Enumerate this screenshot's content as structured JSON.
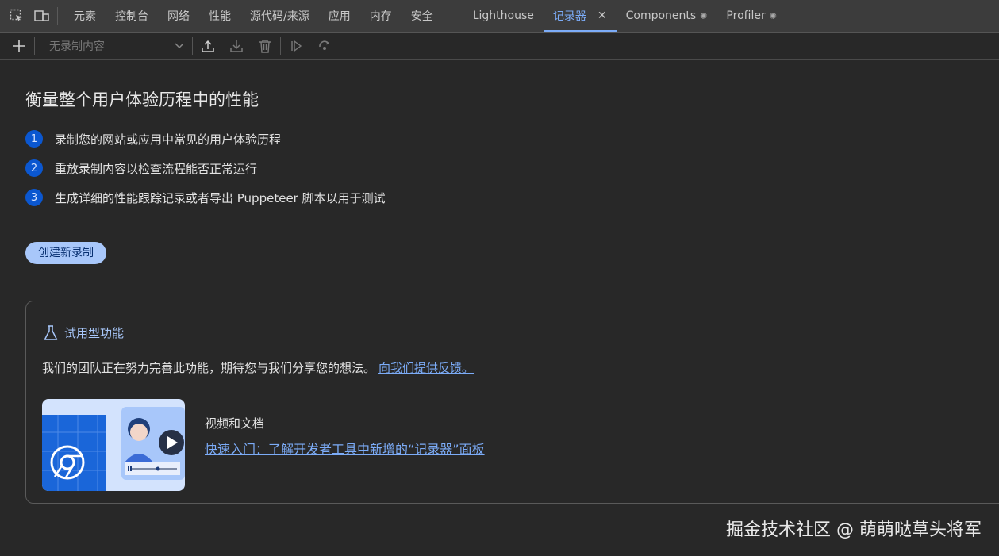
{
  "tabs": [
    {
      "label": "元素"
    },
    {
      "label": "控制台"
    },
    {
      "label": "网络"
    },
    {
      "label": "性能"
    },
    {
      "label": "源代码/来源"
    },
    {
      "label": "应用"
    },
    {
      "label": "内存"
    },
    {
      "label": "安全"
    },
    {
      "label": "Lighthouse"
    },
    {
      "label": "记录器"
    },
    {
      "label": "Components"
    },
    {
      "label": "Profiler"
    }
  ],
  "toolbar": {
    "recording_select_value": "无录制内容"
  },
  "main": {
    "heading": "衡量整个用户体验历程中的性能",
    "steps": [
      {
        "num": "1",
        "text": "录制您的网站或应用中常见的用户体验历程"
      },
      {
        "num": "2",
        "text": "重放录制内容以检查流程能否正常运行"
      },
      {
        "num": "3",
        "text": "生成详细的性能跟踪记录或者导出 Puppeteer 脚本以用于测试"
      }
    ],
    "create_button": "创建新录制"
  },
  "experimental": {
    "title": "试用型功能",
    "description": "我们的团队正在努力完善此功能，期待您与我们分享您的想法。",
    "feedback_link": "向我们提供反馈。",
    "video_label": "视频和文档",
    "video_link": "快速入门：了解开发者工具中新增的“记录器”面板"
  },
  "watermark": "掘金技术社区 @ 萌萌哒草头将军",
  "colors": {
    "background": "#282828",
    "accent": "#7cacf8",
    "button": "#a8c7fa",
    "step_badge": "#0b57d0"
  },
  "icons": [
    "inspect-element-icon",
    "device-toolbar-icon",
    "plus-icon",
    "chevron-down-icon",
    "upload-icon",
    "download-icon",
    "trash-icon",
    "replay-icon",
    "replay-settings-icon",
    "flask-icon",
    "play-icon",
    "chrome-icon",
    "gear-icon",
    "close-icon"
  ]
}
